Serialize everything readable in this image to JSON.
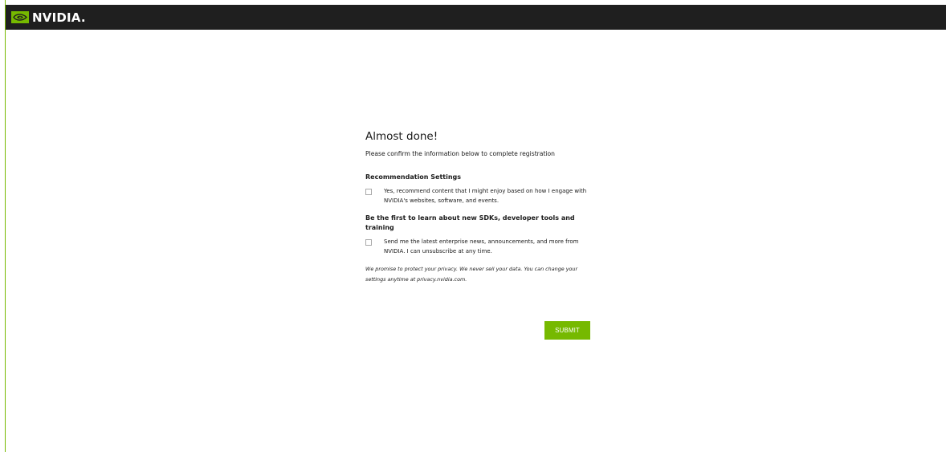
{
  "brand": {
    "name": "NVIDIA.",
    "accent_color": "#76b900",
    "header_color": "#1f1f1f",
    "logo_icon": "nvidia-eye-icon"
  },
  "form": {
    "title": "Almost done!",
    "subtitle": "Please confirm the information below to complete registration",
    "recommendation": {
      "heading": "Recommendation Settings",
      "checkbox_label": "Yes, recommend content that I might enjoy based on how I engage with NVIDIA's websites, software, and events.",
      "checked": false
    },
    "newsletter": {
      "heading": "Be the first to learn about new SDKs, developer tools and training",
      "checkbox_label": "Send me the latest enterprise news, announcements, and more from NVIDIA. I can unsubscribe at any time.",
      "checked": false
    },
    "privacy_note": "We promise to protect your privacy. We never sell your data. You can change your settings anytime at privacy.nvidia.com.",
    "submit_label": "SUBMIT"
  }
}
